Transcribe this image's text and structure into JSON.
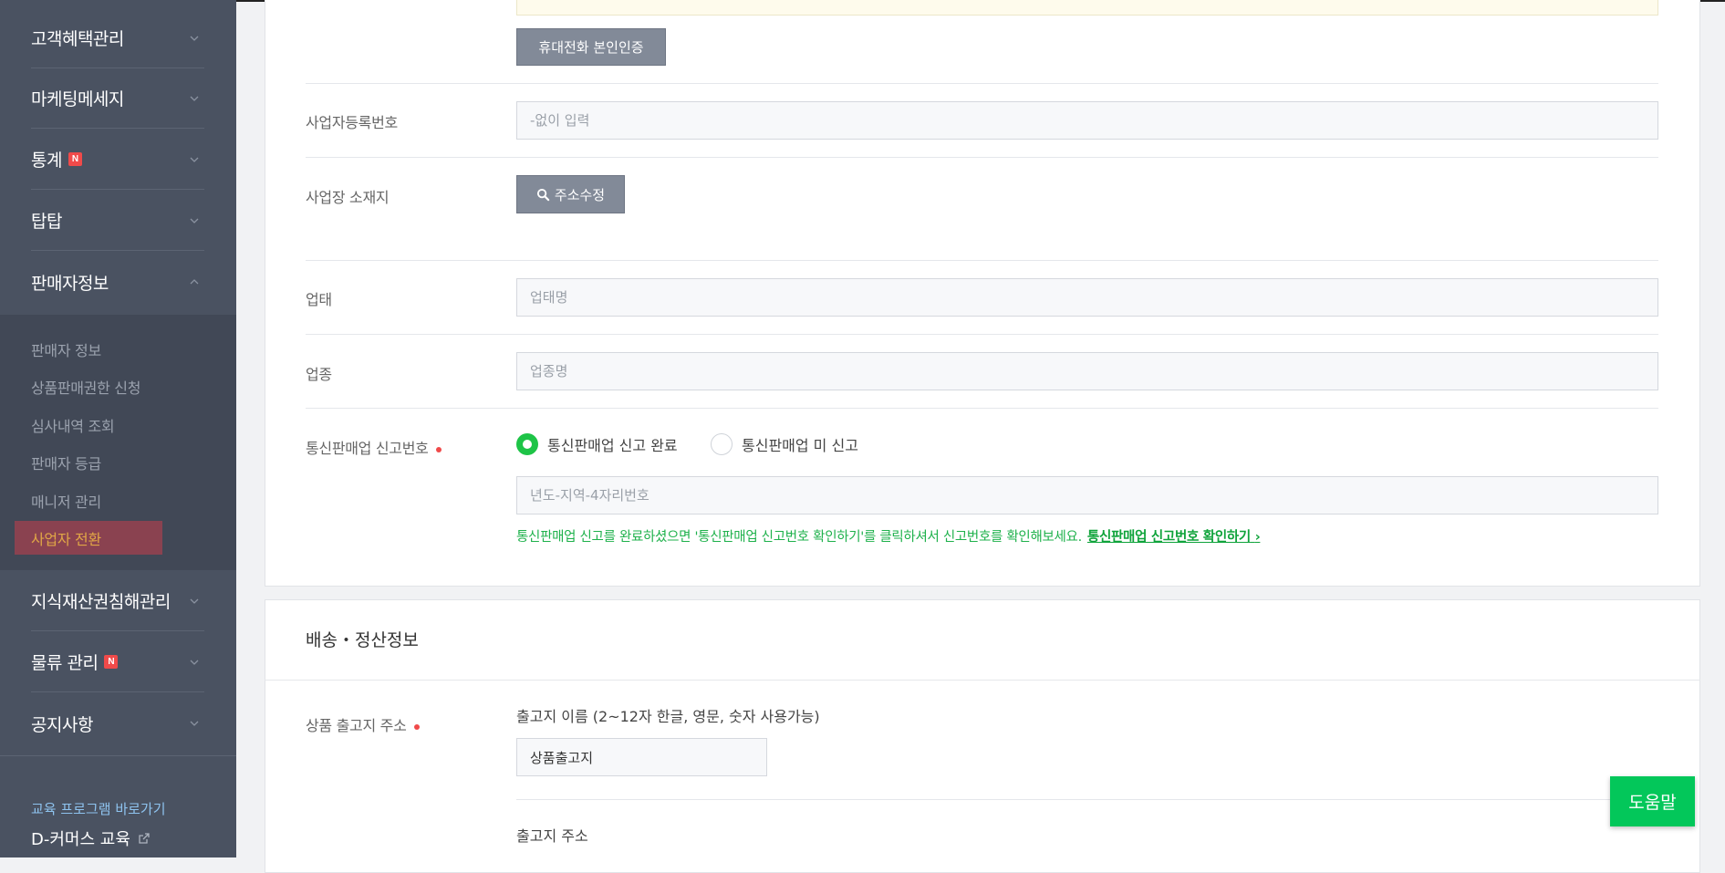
{
  "sidebar": {
    "menu": [
      {
        "label": "고객혜택관리",
        "new": false,
        "expanded": false
      },
      {
        "label": "마케팅메세지",
        "new": false,
        "expanded": false
      },
      {
        "label": "통계",
        "new": true,
        "expanded": false
      },
      {
        "label": "탑탑",
        "new": false,
        "expanded": false
      },
      {
        "label": "판매자정보",
        "new": false,
        "expanded": true
      },
      {
        "label": "지식재산권침해관리",
        "new": false,
        "expanded": false
      },
      {
        "label": "물류 관리",
        "new": true,
        "expanded": false
      },
      {
        "label": "공지사항",
        "new": false,
        "expanded": false
      }
    ],
    "new_badge": "N",
    "submenu": [
      {
        "label": "판매자 정보"
      },
      {
        "label": "상품판매권한 신청"
      },
      {
        "label": "심사내역 조회"
      },
      {
        "label": "판매자 등급"
      },
      {
        "label": "매니저 관리"
      },
      {
        "label": "사업자 전환",
        "active": true
      }
    ],
    "edu_link": "교육 프로그램 바로가기",
    "dcommerce": "D-커머스 교육"
  },
  "form": {
    "phone_verify_button": "휴대전화 본인인증",
    "business_number": {
      "label": "사업자등록번호",
      "placeholder": "-없이 입력",
      "value": ""
    },
    "business_address": {
      "label": "사업장 소재지",
      "button": "주소수정"
    },
    "business_type": {
      "label": "업태",
      "placeholder": "업태명",
      "value": ""
    },
    "business_item": {
      "label": "업종",
      "placeholder": "업종명",
      "value": ""
    },
    "mail_order": {
      "label": "통신판매업 신고번호",
      "options": [
        "통신판매업 신고 완료",
        "통신판매업 미 신고"
      ],
      "selected": "통신판매업 신고 완료",
      "placeholder": "년도-지역-4자리번호",
      "value": "",
      "info": "통신판매업 신고를 완료하셨으면 '통신판매업 신고번호 확인하기'를 클릭하셔서 신고번호를 확인해보세요.",
      "info_link": "통신판매업 신고번호 확인하기",
      "info_link_arrow": "›"
    }
  },
  "shipping": {
    "title": "배송・정산정보",
    "warehouse": {
      "label": "상품 출고지 주소",
      "name_caption": "출고지 이름 (2~12자 한글, 영문, 숫자 사용가능)",
      "name_value": "상품출고지",
      "address_caption": "출고지 주소"
    }
  },
  "help_button": "도움말",
  "colors": {
    "sidebar_bg": "#4a5261",
    "accent_green": "#03c75a",
    "required": "#f04a4a",
    "active_sub": "#e0a646"
  }
}
